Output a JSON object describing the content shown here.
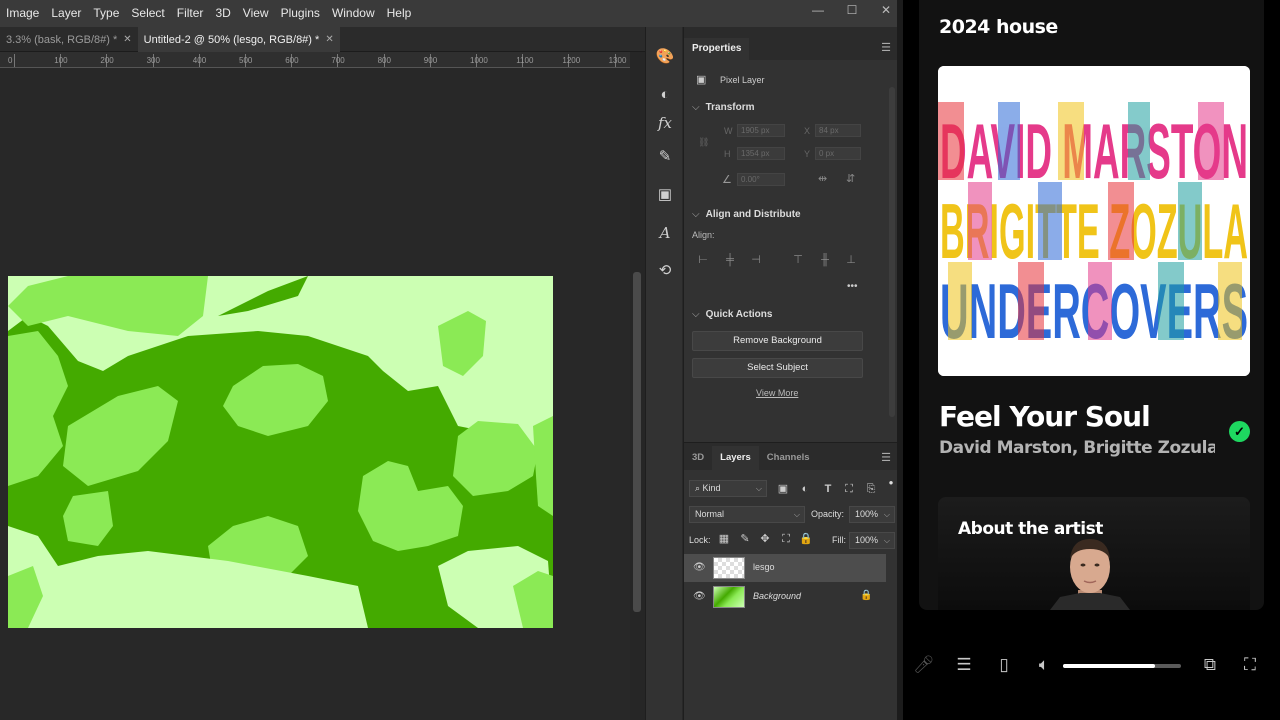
{
  "photoshop": {
    "menu": [
      "Image",
      "Layer",
      "Type",
      "Select",
      "Filter",
      "3D",
      "View",
      "Plugins",
      "Window",
      "Help"
    ],
    "window_controls": [
      "—",
      "☐",
      "✕"
    ],
    "tabs": [
      {
        "label": "3.3% (bask, RGB/8#) *",
        "close": "✕",
        "active": false
      },
      {
        "label": "Untitled-2 @ 50% (lesgo, RGB/8#) *",
        "close": "✕",
        "active": true
      }
    ],
    "ruler_ticks": [
      "0",
      "100",
      "200",
      "300",
      "400",
      "500",
      "600",
      "700",
      "800",
      "900",
      "1000",
      "1100",
      "1200",
      "1300"
    ],
    "properties": {
      "tab": "Properties",
      "layer_type": "Pixel Layer",
      "transform": {
        "title": "Transform",
        "w_label": "W",
        "w_value": "1905 px",
        "x_label": "X",
        "x_value": "84 px",
        "h_label": "H",
        "h_value": "1354 px",
        "y_label": "Y",
        "y_value": "0 px",
        "angle_value": "0.00°"
      },
      "align": {
        "title": "Align and Distribute",
        "label": "Align:",
        "more": "•••"
      },
      "quick_actions": {
        "title": "Quick Actions",
        "remove_bg": "Remove Background",
        "select_subject": "Select Subject",
        "view_more": "View More"
      }
    },
    "layers_panel": {
      "tabs": [
        "3D",
        "Layers",
        "Channels"
      ],
      "active_tab": "Layers",
      "filter": "Kind",
      "blend_mode": "Normal",
      "opacity_label": "Opacity:",
      "opacity_value": "100%",
      "lock_label": "Lock:",
      "fill_label": "Fill:",
      "fill_value": "100%",
      "layers": [
        {
          "name": "lesgo",
          "selected": true,
          "locked": false
        },
        {
          "name": "Background",
          "selected": false,
          "locked": true
        }
      ]
    },
    "canvas_colors": {
      "light": "#ccffb3",
      "mid": "#8bea55",
      "dark": "#44aa00"
    }
  },
  "spotify": {
    "playlist_title": "2024 house",
    "cover_lines": [
      "DAVID MARSTON",
      "BRIGITTE ZOZULA",
      "UNDERCOVERS"
    ],
    "song_title": "Feel Your Soul",
    "artists": "David Marston, Brigitte Zozula",
    "about_title": "About the artist",
    "volume_level": 0.78,
    "accent": "#1ed760"
  }
}
